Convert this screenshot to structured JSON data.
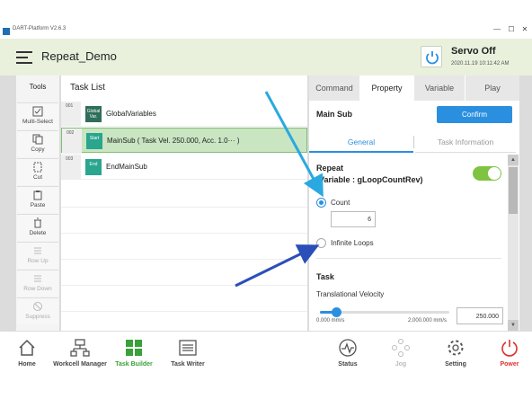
{
  "titlebar": {
    "title": "DART-Platform V2.6.3",
    "minimize": "—",
    "maximize": "☐",
    "close": "✕"
  },
  "header": {
    "title": "Repeat_Demo",
    "servo_status": "Servo Off",
    "datetime": "2020.11.19 10:11:42 AM"
  },
  "tools": {
    "header": "Tools",
    "items": [
      {
        "label": "Multi-Select",
        "icon": "multi-select-icon",
        "enabled": true
      },
      {
        "label": "Copy",
        "icon": "copy-icon",
        "enabled": true
      },
      {
        "label": "Cut",
        "icon": "cut-icon",
        "enabled": true
      },
      {
        "label": "Paste",
        "icon": "paste-icon",
        "enabled": true
      },
      {
        "label": "Delete",
        "icon": "delete-icon",
        "enabled": true
      },
      {
        "label": "Row Up",
        "icon": "row-up-icon",
        "enabled": false
      },
      {
        "label": "Row Down",
        "icon": "row-down-icon",
        "enabled": false
      },
      {
        "label": "Suppress",
        "icon": "suppress-icon",
        "enabled": false
      }
    ]
  },
  "tasklist": {
    "header": "Task List",
    "rows": [
      {
        "num": "001",
        "tag": "Global Var.",
        "tag_color": "#2e6e5a",
        "name": "GlobalVariables",
        "selected": false
      },
      {
        "num": "002",
        "tag": "Start",
        "tag_color": "#2aa58e",
        "name": "MainSub  ( Task Vel. 250.000, Acc. 1.0··· )",
        "selected": true
      },
      {
        "num": "003",
        "tag": "End",
        "tag_color": "#2aa58e",
        "name": "EndMainSub",
        "selected": false
      }
    ]
  },
  "property": {
    "tabs": [
      "Command",
      "Property",
      "Variable",
      "Play"
    ],
    "active_tab": "Property",
    "subtitle": "Main Sub",
    "confirm_label": "Confirm",
    "subtabs": [
      "General",
      "Task Information"
    ],
    "repeat_title": "Repeat",
    "repeat_variable": "(Variable : gLoopCountRev)",
    "repeat_enabled": true,
    "option_count": "Count",
    "count_value": "6",
    "option_infinite": "Infinite Loops",
    "selected_option": "Count",
    "task_title": "Task",
    "velocity_label": "Translational Velocity",
    "velocity_min": "0.000 mm/s",
    "velocity_max": "2,000.000 mm/s",
    "velocity_value": "250.000",
    "velocity_fraction": 0.125
  },
  "nav": {
    "items": [
      {
        "label": "Home",
        "icon": "home-icon",
        "state": "normal"
      },
      {
        "label": "Workcell Manager",
        "icon": "workcell-icon",
        "state": "normal"
      },
      {
        "label": "Task Builder",
        "icon": "task-builder-icon",
        "state": "active"
      },
      {
        "label": "Task Writer",
        "icon": "task-writer-icon",
        "state": "normal"
      },
      {
        "label": "Status",
        "icon": "status-icon",
        "state": "normal"
      },
      {
        "label": "Jog",
        "icon": "jog-icon",
        "state": "disabled"
      },
      {
        "label": "Setting",
        "icon": "gear-icon",
        "state": "normal"
      },
      {
        "label": "Power",
        "icon": "power-icon",
        "state": "power"
      }
    ]
  },
  "colors": {
    "accent": "#2b8fe0",
    "header_bg": "#e9f1dd",
    "active_nav": "#3aa03a",
    "toggle_on": "#7ec442",
    "power": "#e03030"
  }
}
